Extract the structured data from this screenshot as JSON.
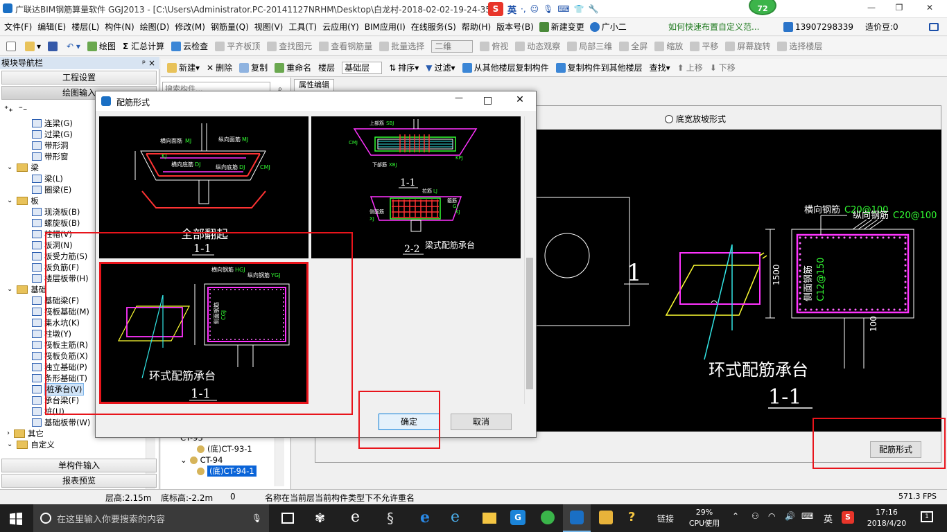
{
  "app": {
    "title": "广联达BIM钢筋算量软件 GGJ2013 - [C:\\Users\\Administrator.PC-20141127NRHM\\Desktop\\白龙村-2018-02-02-19-24-35",
    "window_buttons": [
      "—",
      "❐",
      "✕"
    ]
  },
  "ime": {
    "lang": "英",
    "badge": "72"
  },
  "menu": [
    "文件(F)",
    "编辑(E)",
    "楼层(L)",
    "构件(N)",
    "绘图(D)",
    "修改(M)",
    "钢筋量(Q)",
    "视图(V)",
    "工具(T)",
    "云应用(Y)",
    "BIM应用(I)",
    "在线服务(S)",
    "帮助(H)",
    "版本号(B)",
    "新建变更",
    "广小二"
  ],
  "menu_right": {
    "help_link": "如何快速布置自定义范...",
    "phone": "13907298339",
    "beans": "造价豆:0"
  },
  "toolbar1": [
    {
      "label": "绘图",
      "dis": false
    },
    {
      "label": "汇总计算",
      "dis": false
    },
    {
      "label": "云检查",
      "dis": false
    },
    {
      "label": "平齐板顶",
      "dis": true
    },
    {
      "label": "查找图元",
      "dis": true
    },
    {
      "label": "查看钢筋量",
      "dis": true
    },
    {
      "label": "批量选择",
      "dis": true
    },
    {
      "label": "二维",
      "dis": true
    },
    {
      "label": "俯视",
      "dis": true
    },
    {
      "label": "动态观察",
      "dis": true
    },
    {
      "label": "局部三维",
      "dis": true
    },
    {
      "label": "全屏",
      "dis": true
    },
    {
      "label": "缩放",
      "dis": true
    },
    {
      "label": "平移",
      "dis": true
    },
    {
      "label": "屏幕旋转",
      "dis": true
    },
    {
      "label": "选择楼层",
      "dis": true
    }
  ],
  "toolbar2": [
    {
      "label": "新建",
      "dis": false
    },
    {
      "label": "删除",
      "dis": false
    },
    {
      "label": "复制",
      "dis": false
    },
    {
      "label": "重命名",
      "dis": false
    },
    {
      "label": "楼层",
      "dis": false
    },
    {
      "label": "基础层",
      "dis": false
    },
    {
      "label": "排序",
      "dis": false
    },
    {
      "label": "过滤",
      "dis": false
    },
    {
      "label": "从其他楼层复制构件",
      "dis": false
    },
    {
      "label": "复制构件到其他楼层",
      "dis": false
    },
    {
      "label": "查找",
      "dis": false
    },
    {
      "label": "上移",
      "dis": true
    },
    {
      "label": "下移",
      "dis": true
    }
  ],
  "nav": {
    "header": "模块导航栏",
    "pin": "ᵖ ×",
    "btn_project": "工程设置",
    "btn_draw": "绘图输入",
    "btn_single": "单构件输入",
    "btn_report": "报表预览",
    "tree": [
      {
        "label": "连梁(G)",
        "lvl": 2,
        "type": "item"
      },
      {
        "label": "过梁(G)",
        "lvl": 2,
        "type": "item"
      },
      {
        "label": "带形洞",
        "lvl": 2,
        "type": "item"
      },
      {
        "label": "带形窗",
        "lvl": 2,
        "type": "item"
      },
      {
        "label": "梁",
        "lvl": 1,
        "type": "folder"
      },
      {
        "label": "梁(L)",
        "lvl": 2,
        "type": "item"
      },
      {
        "label": "圈梁(E)",
        "lvl": 2,
        "type": "item"
      },
      {
        "label": "板",
        "lvl": 1,
        "type": "folder"
      },
      {
        "label": "现浇板(B)",
        "lvl": 2,
        "type": "item"
      },
      {
        "label": "螺旋板(B)",
        "lvl": 2,
        "type": "item"
      },
      {
        "label": "柱帽(V)",
        "lvl": 2,
        "type": "item"
      },
      {
        "label": "板洞(N)",
        "lvl": 2,
        "type": "item"
      },
      {
        "label": "板受力筋(S)",
        "lvl": 2,
        "type": "item"
      },
      {
        "label": "板负筋(F)",
        "lvl": 2,
        "type": "item"
      },
      {
        "label": "楼层板带(H)",
        "lvl": 2,
        "type": "item"
      },
      {
        "label": "基础",
        "lvl": 1,
        "type": "folder"
      },
      {
        "label": "基础梁(F)",
        "lvl": 2,
        "type": "item"
      },
      {
        "label": "筏板基础(M)",
        "lvl": 2,
        "type": "item"
      },
      {
        "label": "集水坑(K)",
        "lvl": 2,
        "type": "item"
      },
      {
        "label": "柱墩(Y)",
        "lvl": 2,
        "type": "item"
      },
      {
        "label": "筏板主筋(R)",
        "lvl": 2,
        "type": "item"
      },
      {
        "label": "筏板负筋(X)",
        "lvl": 2,
        "type": "item"
      },
      {
        "label": "独立基础(P)",
        "lvl": 2,
        "type": "item"
      },
      {
        "label": "条形基础(T)",
        "lvl": 2,
        "type": "item"
      },
      {
        "label": "桩承台(V)",
        "lvl": 2,
        "type": "item",
        "sel": true
      },
      {
        "label": "承台梁(F)",
        "lvl": 2,
        "type": "item"
      },
      {
        "label": "桩(U)",
        "lvl": 2,
        "type": "item"
      },
      {
        "label": "基础板带(W)",
        "lvl": 2,
        "type": "item"
      },
      {
        "label": "其它",
        "lvl": 1,
        "type": "folder",
        "collapsed": true
      },
      {
        "label": "自定义",
        "lvl": 1,
        "type": "folder"
      }
    ]
  },
  "component_list": {
    "search_placeholder": "搜索构件...",
    "items": [
      {
        "label": "CT-93",
        "lvl": 1
      },
      {
        "label": "(底)CT-93-1",
        "lvl": 2
      },
      {
        "label": "CT-94",
        "lvl": 1
      },
      {
        "label": "(底)CT-94-1",
        "lvl": 2,
        "sel": true
      }
    ]
  },
  "props_tab": "属性编辑",
  "preview": {
    "radio_label": "底宽放坡形式",
    "rebar_button": "配筋形式",
    "title": "环式配筋承台",
    "section": "1-1",
    "section_left": "1",
    "label_h": "横向钢筋",
    "val_h": "C20@100",
    "label_v": "纵向钢筋",
    "val_v": "C20@100",
    "label_side": "侧面钢筋",
    "val_side": "C12@150",
    "dim": "1500",
    "dim2": "100"
  },
  "dialog": {
    "title": "配筋形式",
    "tile1": {
      "title": "全部翻起",
      "section": "1-1",
      "l1": "横向面筋",
      "v1": "MJ",
      "l2": "纵向面筋",
      "v2": "MJ",
      "l3": "横向底筋",
      "v3": "DJ",
      "l4": "纵向底筋",
      "v4": "DJ",
      "v5": "CMJ",
      "v6": "KJ"
    },
    "tile2": {
      "title": "梁式配筋承台",
      "section1": "1-1",
      "section2": "2-2",
      "l1": "上部筋",
      "v1": "SBJ",
      "l2": "下部筋",
      "v2": "XBJ",
      "l3": "侧面筋",
      "v3": "CMJ",
      "l4": "拉筋",
      "v4": "LJ",
      "l5": "箍筋",
      "v5": "GJ",
      "v6": "KPJ",
      "v7": "KJ",
      "v8": "XJ"
    },
    "tile3": {
      "title": "环式配筋承台",
      "section": "1-1",
      "l1": "横向钢筋",
      "v1": "HGJ",
      "l2": "纵向钢筋",
      "v2": "YGJ",
      "l3": "侧面钢筋",
      "v3": "CGJ"
    },
    "ok": "确定",
    "cancel": "取消"
  },
  "status": {
    "floor_height": "层高:2.15m",
    "base_height": "底标高:-2.2m",
    "zero": "0",
    "message": "名称在当前层当前构件类型下不允许重名",
    "fps": "571.3 FPS"
  },
  "taskbar": {
    "search_placeholder": "在这里输入你要搜索的内容",
    "link": "链接",
    "cpu_pct": "29%",
    "cpu_label": "CPU使用",
    "lang": "英",
    "time": "17:16",
    "date": "2018/4/20",
    "notify": "1"
  }
}
